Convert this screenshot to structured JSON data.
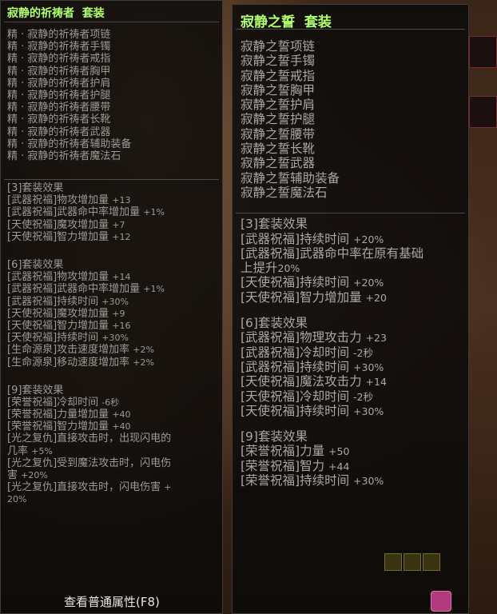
{
  "left": {
    "title": "寂静的祈祷者  套装",
    "items": [
      "精 · 寂静的祈祷者项链",
      "精 · 寂静的祈祷者手镯",
      "精 · 寂静的祈祷者戒指",
      "精 · 寂静的祈祷者胸甲",
      "精 · 寂静的祈祷者护肩",
      "精 · 寂静的祈祷者护腿",
      "精 · 寂静的祈祷者腰带",
      "精 · 寂静的祈祷者长靴",
      "精 · 寂静的祈祷者武器",
      "精 · 寂静的祈祷者辅助装备",
      "精 · 寂静的祈祷者魔法石"
    ],
    "set3": {
      "title": "[3]套装效果",
      "lines": [
        {
          "text": "[武器祝福]物攻增加量 ",
          "val": "+13"
        },
        {
          "text": "[武器祝福]武器命中率增加量 ",
          "val": "+1%"
        },
        {
          "text": "[天使祝福]魔攻增加量 ",
          "val": "+7"
        },
        {
          "text": "[天使祝福]智力增加量 ",
          "val": "+12"
        }
      ]
    },
    "set6": {
      "title": "[6]套装效果",
      "lines": [
        {
          "text": "[武器祝福]物攻增加量 ",
          "val": "+14"
        },
        {
          "text": "[武器祝福]武器命中率增加量 ",
          "val": "+1%"
        },
        {
          "text": "[武器祝福]持续时间 ",
          "val": "+30%"
        },
        {
          "text": "[天使祝福]魔攻增加量 ",
          "val": "+9"
        },
        {
          "text": "[天使祝福]智力增加量 ",
          "val": "+16"
        },
        {
          "text": "[天使祝福]持续时间 ",
          "val": "+30%"
        },
        {
          "text": "[生命源泉]攻击速度增加率 ",
          "val": "+2%"
        },
        {
          "text": "[生命源泉]移动速度增加率 ",
          "val": "+2%"
        }
      ]
    },
    "set9": {
      "title": "[9]套装效果",
      "lines": [
        {
          "text": "[荣誉祝福]冷却时间 ",
          "val": "-6秒"
        },
        {
          "text": "[荣誉祝福]力量增加量 ",
          "val": "+40"
        },
        {
          "text": "[荣誉祝福]智力增加量 ",
          "val": "+40"
        },
        {
          "text": "[光之复仇]直接攻击时，出现闪电的",
          "val": ""
        },
        {
          "text": "几率 ",
          "val": "+5%"
        },
        {
          "text": "[光之复仇]受到魔法攻击时，闪电伤",
          "val": ""
        },
        {
          "text": "害 ",
          "val": "+20%"
        },
        {
          "text": "[光之复仇]直接攻击时，闪电伤害 ",
          "val": "+"
        },
        {
          "text": "",
          "val": "20%"
        }
      ]
    }
  },
  "right": {
    "title": "寂静之誓  套装",
    "items": [
      "寂静之誓项链",
      "寂静之誓手镯",
      "寂静之誓戒指",
      "寂静之誓胸甲",
      "寂静之誓护肩",
      "寂静之誓护腿",
      "寂静之誓腰带",
      "寂静之誓长靴",
      "寂静之誓武器",
      "寂静之誓辅助装备",
      "寂静之誓魔法石"
    ],
    "set3": {
      "title": "[3]套装效果",
      "lines": [
        {
          "text": "[武器祝福]持续时间 ",
          "val": "+20%"
        },
        {
          "text": "[武器祝福]武器命中率在原有基础",
          "val": ""
        },
        {
          "text": "上提升",
          "val": "20%"
        },
        {
          "text": "[天使祝福]持续时间 ",
          "val": "+20%"
        },
        {
          "text": "[天使祝福]智力增加量 ",
          "val": "+20"
        }
      ]
    },
    "set6": {
      "title": "[6]套装效果",
      "lines": [
        {
          "text": "[武器祝福]物理攻击力 ",
          "val": "+23"
        },
        {
          "text": "[武器祝福]冷却时间 ",
          "val": "-2秒"
        },
        {
          "text": "[武器祝福]持续时间 ",
          "val": "+30%"
        },
        {
          "text": "[天使祝福]魔法攻击力 ",
          "val": "+14"
        },
        {
          "text": "[天使祝福]冷却时间 ",
          "val": "-2秒"
        },
        {
          "text": "[天使祝福]持续时间 ",
          "val": "+30%"
        }
      ]
    },
    "set9": {
      "title": "[9]套装效果",
      "lines": [
        {
          "text": "[荣誉祝福]力量 ",
          "val": "+50"
        },
        {
          "text": "[荣誉祝福]智力 ",
          "val": "+44"
        },
        {
          "text": "[荣誉祝福]持续时间 ",
          "val": "+30%"
        }
      ]
    }
  },
  "footer": {
    "label": "查看普通属性(F8)"
  },
  "colors": {
    "title": "#b0ff6e",
    "text": "#a8a8a8",
    "panel_bg": "#080808"
  }
}
